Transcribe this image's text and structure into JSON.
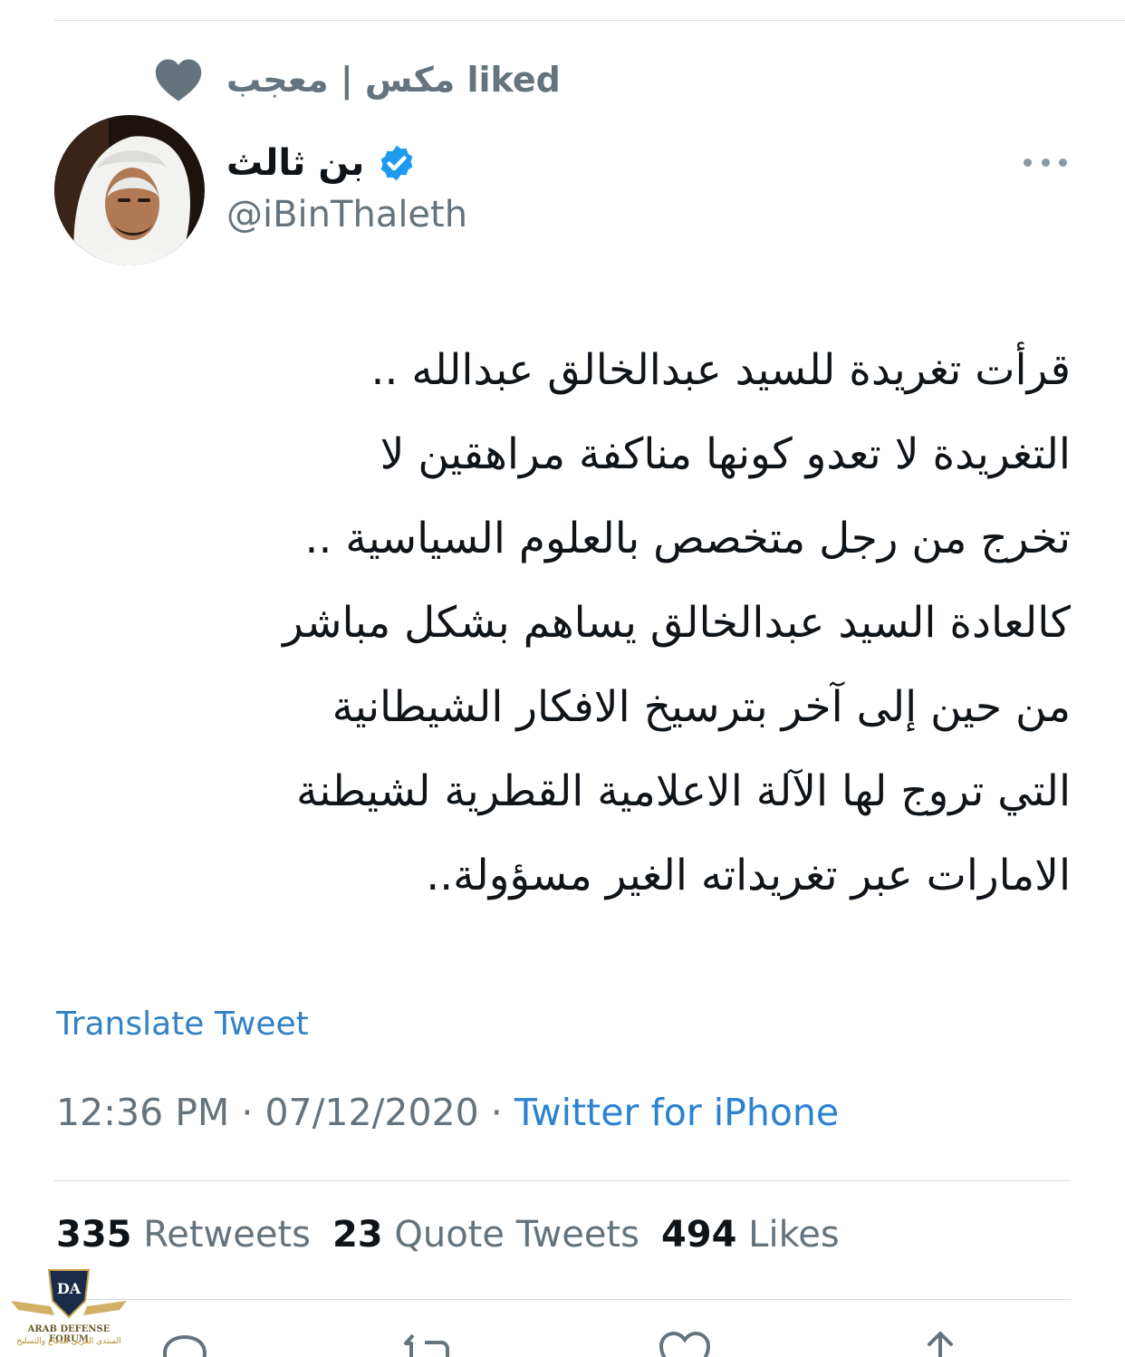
{
  "social_context": {
    "liked_by": "مكس | معجب liked",
    "icon": "heart-icon"
  },
  "author": {
    "display_name": "بن ثالث",
    "handle": "@iBinThaleth",
    "verified": true,
    "avatar": "profile-photo"
  },
  "tweet": {
    "text": "قرأت تغريدة للسيد عبدالخالق عبدالله ..\nالتغريدة لا تعدو كونها مناكفة مراهقين لا\nتخرج من رجل متخصص بالعلوم السياسية ..\nكالعادة السيد عبدالخالق يساهم بشكل مباشر\nمن حين إلى آخر بترسيخ الافكار الشيطانية\nالتي تروج لها الآلة الاعلامية القطرية لشيطنة\nالامارات عبر تغريداته الغير مسؤولة..",
    "translate_label": "Translate Tweet",
    "time": "12:36 PM",
    "separator": "·",
    "date": "07/12/2020",
    "source": "Twitter for iPhone"
  },
  "stats": {
    "retweets_count": "335",
    "retweets_label": "Retweets",
    "quotes_count": "23",
    "quotes_label": "Quote Tweets",
    "likes_count": "494",
    "likes_label": "Likes"
  },
  "actions": [
    "reply-icon",
    "retweet-icon",
    "like-icon",
    "share-icon"
  ],
  "watermark": {
    "title": "ARAB DEFENSE FORUM",
    "subtitle": "المنتدى العربي للدفاع والتسليح",
    "monogram": "DA"
  },
  "colors": {
    "accent": "#2b82d1",
    "secondary_text": "#65737d",
    "primary_text": "#0f1419",
    "verified": "#1d9bf0"
  }
}
